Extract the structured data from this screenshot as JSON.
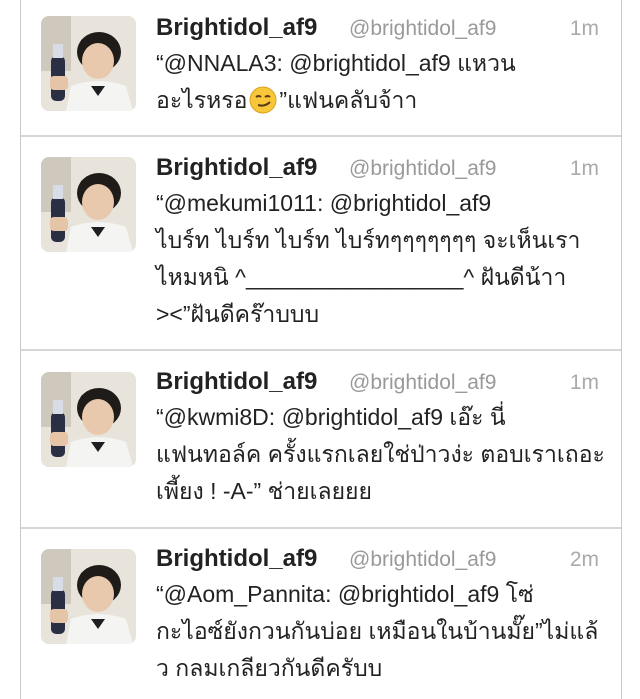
{
  "tweets": [
    {
      "name": "Brightidol_af9",
      "handle": "@brightidol_af9",
      "time": "1m",
      "lines": [
        "“@NNALA3: @brightidol_af9 แหวน",
        "อะไรหรอ",
        "”แฟนคลับจ้าา"
      ],
      "emoji": "smirking-face-icon"
    },
    {
      "name": "Brightidol_af9",
      "handle": "@brightidol_af9",
      "time": "1m",
      "lines": [
        "“@mekumi1011: @brightidol_af9",
        "ไบร์ท ไบร์ท ไบร์ท ไบร์ทๆๆๆๆๆๆๆ  จะเห็นเรา",
        "ไหมหนิ ^_________________^ ฝันดีน้าา",
        "><”ฝันดีคร๊าบบบ"
      ]
    },
    {
      "name": "Brightidol_af9",
      "handle": "@brightidol_af9",
      "time": "1m",
      "lines": [
        "“@kwmi8D: @brightidol_af9 เอ๊ะ นี่",
        "แฟนทอล์ค ครั้งแรกเลยใช่ป่าวง่ะ ตอบเราเถอะ",
        "เพี้ยง ! -A-” ช่ายเลยยย"
      ]
    },
    {
      "name": "Brightidol_af9",
      "handle": "@brightidol_af9",
      "time": "2m",
      "lines": [
        "“@Aom_Pannita: @brightidol_af9 โซ่",
        "กะไอซ์ยังกวนกันบ่อย เหมือนในบ้านมั๊ย”ไม่แล้",
        "ว กลมเกลียวกันดีครับบ"
      ]
    }
  ],
  "colors": {
    "name": "#222222",
    "handle": "#999999",
    "time": "#aaaaaa",
    "divider": "#d6d6d6"
  }
}
